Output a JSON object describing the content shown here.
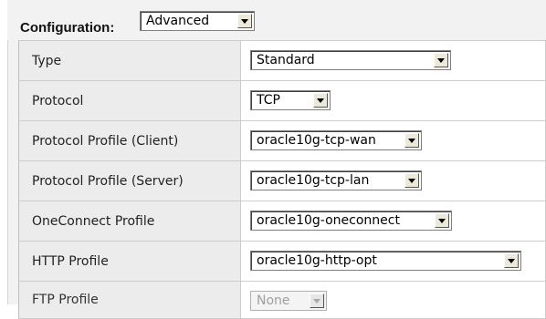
{
  "config_bar": {
    "label": "Configuration:",
    "mode_value": "Advanced"
  },
  "rows": [
    {
      "label": "Type",
      "value": "Standard"
    },
    {
      "label": "Protocol",
      "value": "TCP"
    },
    {
      "label": "Protocol Profile (Client)",
      "value": "oracle10g-tcp-wan"
    },
    {
      "label": "Protocol Profile (Server)",
      "value": "oracle10g-tcp-lan"
    },
    {
      "label": "OneConnect Profile",
      "value": "oracle10g-oneconnect"
    },
    {
      "label": "HTTP Profile",
      "value": "oracle10g-http-opt"
    },
    {
      "label": "FTP Profile",
      "value": "None",
      "disabled": true
    }
  ]
}
